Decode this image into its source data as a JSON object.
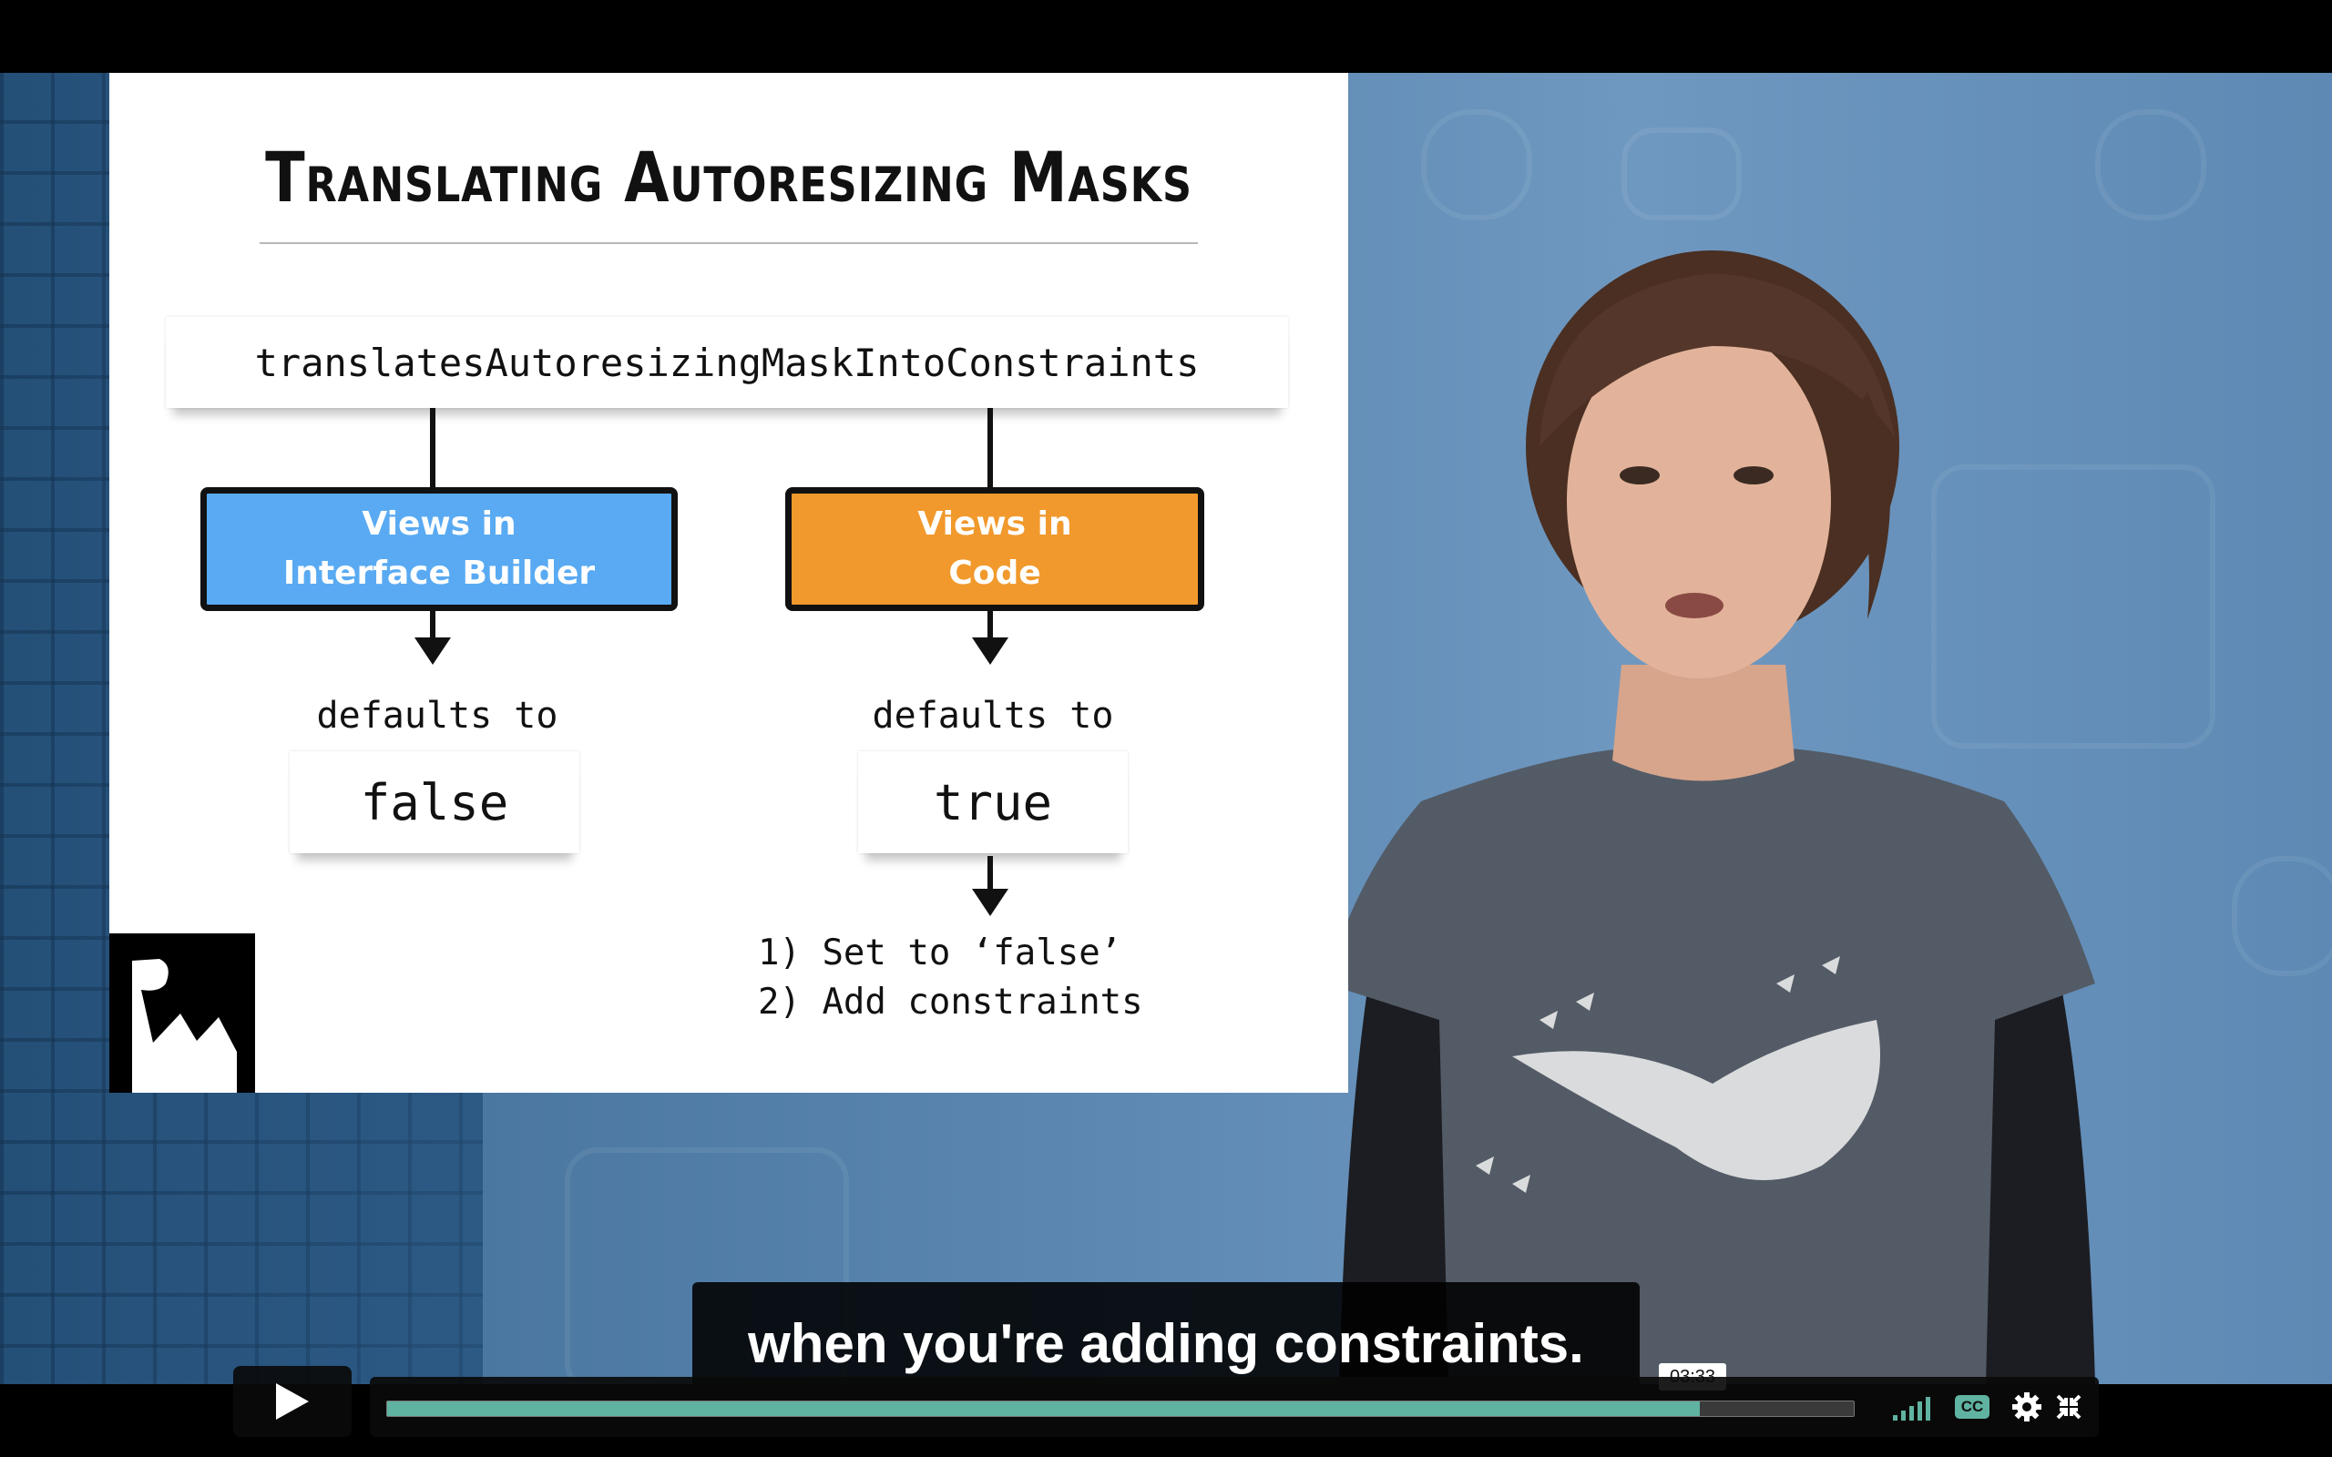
{
  "slide": {
    "title": "Translating Autoresizing Masks",
    "property": "translatesAutoresizingMaskIntoConstraints",
    "left_branch": {
      "line1": "Views in",
      "line2": "Interface Builder",
      "defaults": "defaults to",
      "value": "false",
      "color": "#59aaf2"
    },
    "right_branch": {
      "line1": "Views in",
      "line2": "Code",
      "defaults": "defaults to",
      "value": "true",
      "color": "#f1992c",
      "step1": "1) Set to ‘false’",
      "step2": "2) Add constraints"
    },
    "logo": "raywenderlich-logo"
  },
  "caption": "when you're adding constraints.",
  "controls": {
    "play_icon": "play-icon",
    "time": "03:33",
    "progress_fraction": 0.895,
    "accent_color": "#5fb3a0",
    "volume_icon": "volume-bars-icon",
    "cc_label": "CC",
    "settings_icon": "gear-icon",
    "fullscreen_icon": "fullscreen-exit-icon"
  }
}
